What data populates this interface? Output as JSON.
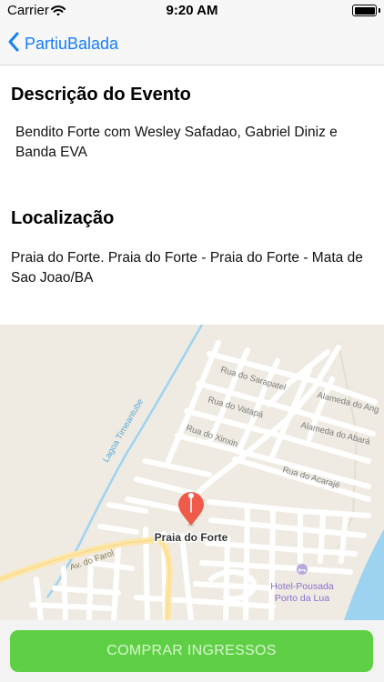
{
  "status_bar": {
    "carrier": "Carrier",
    "time": "9:20 AM",
    "battery_level": 1.0
  },
  "nav": {
    "back_label": "PartiuBalada"
  },
  "description": {
    "title": "Descrição do Evento",
    "text": "Bendito Forte com Wesley Safadao, Gabriel Diniz e Banda EVA"
  },
  "location": {
    "title": "Localização",
    "address": "Praia do Forte. Praia do Forte - Praia do Forte - Mata de Sao Joao/BA"
  },
  "map": {
    "pin_label": "Praia do Forte",
    "streets": {
      "sarapatel": "Rua do Sarapatel",
      "alameda_ang": "Alameda do Ang",
      "vatapa": "Rua do Vatapá",
      "alameda_abara": "Alameda do Abará",
      "xinxin": "Rua do Xinxin",
      "acaraje": "Rua do Acarajé",
      "lagoa": "Lagoa Timeantube",
      "farol": "Av. do Farol"
    },
    "poi": {
      "line1": "Hotel-Pousada",
      "line2": "Porto da Lua"
    },
    "colors": {
      "land": "#efebe2",
      "road": "#ffffff",
      "water": "#9dd3f1",
      "main_road": "#fde6a6",
      "pin": "#f05a4a"
    }
  },
  "action": {
    "buy_label": "COMPRAR INGRESSOS",
    "color": "#5fd046"
  }
}
